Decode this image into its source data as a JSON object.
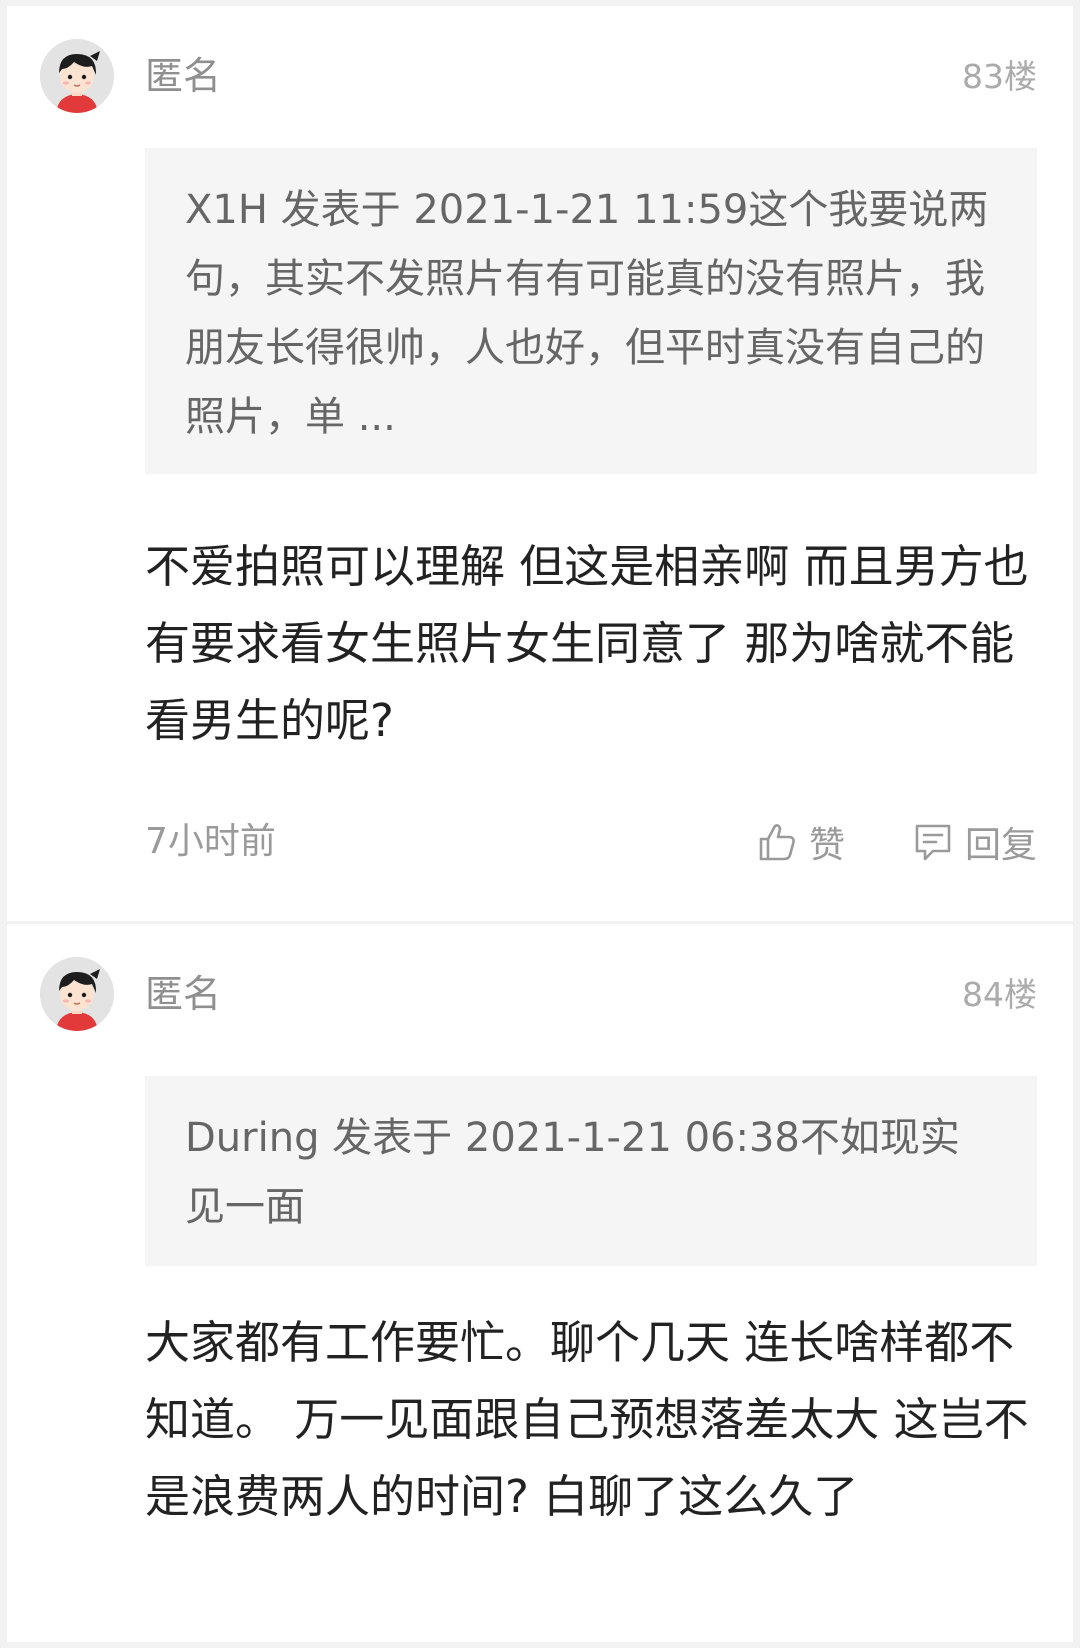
{
  "posts": [
    {
      "author": "匿名",
      "floor": "83楼",
      "quote": "X1H 发表于 2021-1-21 11:59这个我要说两句，其实不发照片有有可能真的没有照片，我朋友长得很帅，人也好，但平时真没有自己的照片，单 ...",
      "content": "不爱拍照可以理解  但这是相亲啊 而且男方也有要求看女生照片女生同意了 那为啥就不能看男生的呢?",
      "time": "7小时前",
      "like_label": "赞",
      "reply_label": "回复"
    },
    {
      "author": "匿名",
      "floor": "84楼",
      "quote": "During 发表于 2021-1-21 06:38不如现实见一面",
      "content": "大家都有工作要忙。聊个几天 连长啥样都不知道。 万一见面跟自己预想落差太大 这岂不是浪费两人的时间?  白聊了这么久了"
    }
  ],
  "colors": {
    "background": "#f2f2f2",
    "card": "#ffffff",
    "quote_bg": "#f5f5f5",
    "meta_text": "#9a9a9a",
    "body_text": "#222222",
    "avatar_shirt": "#e23a3a"
  },
  "icons": {
    "avatar": "anonymous-avatar-icon",
    "like": "thumbs-up-icon",
    "reply": "comment-icon"
  }
}
